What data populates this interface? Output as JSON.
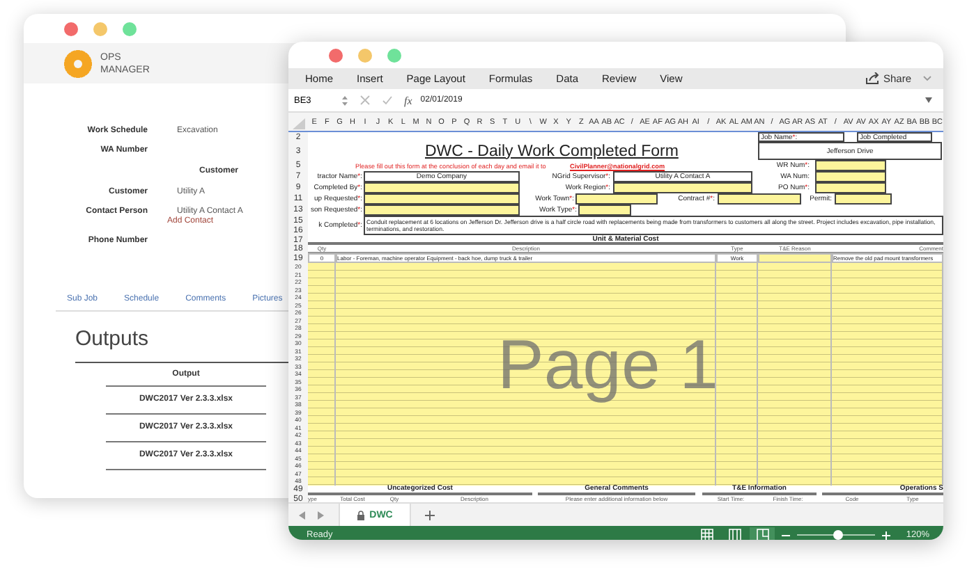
{
  "back_window": {
    "app_name": "OPS MANAGER",
    "fields": [
      {
        "kind": "field",
        "label": "Work Schedule",
        "value": "Excavation"
      },
      {
        "kind": "field",
        "label": "WA Number"
      },
      {
        "kind": "heading",
        "label": "Customer"
      },
      {
        "kind": "field",
        "label": "Customer",
        "value": "Utility A"
      },
      {
        "kind": "field",
        "label": "Contact Person",
        "value": "Utility A Contact A"
      },
      {
        "kind": "link",
        "label": "Add Contact"
      },
      {
        "kind": "field",
        "label": "Phone Number"
      }
    ],
    "tabs": [
      "Sub Job",
      "Schedule",
      "Comments",
      "Pictures"
    ],
    "outputs": {
      "title": "Outputs",
      "column": "Output",
      "rows": [
        "DWC2017 Ver 2.3.3.xlsx",
        "DWC2017 Ver 2.3.3.xlsx",
        "DWC2017 Ver 2.3.3.xlsx"
      ]
    }
  },
  "excel": {
    "menu": [
      "Home",
      "Insert",
      "Page Layout",
      "Formulas",
      "Data",
      "Review",
      "View"
    ],
    "share_label": "Share",
    "name_box": "BE3",
    "function_label": "fx",
    "formula": "02/01/2019",
    "column_letters": [
      "E",
      "F",
      "G",
      "H",
      "I",
      "J",
      "K",
      "L",
      "M",
      "N",
      "O",
      "P",
      "Q",
      "R",
      "S",
      "T",
      "U",
      "\\",
      "W",
      "X",
      "Y",
      "Z",
      "AA",
      "AB",
      "AC",
      "/",
      "AE",
      "AF",
      "AG",
      "AH",
      "AI",
      "/",
      "AK",
      "AL",
      "AM",
      "AN",
      "/",
      "AG",
      "AR",
      "AS",
      "AT",
      "/",
      "AV",
      "AV",
      "AX",
      "AY",
      "AZ",
      "BA",
      "BB",
      "BC"
    ],
    "sheet_lines": [
      {
        "numbers": [
          "2"
        ],
        "items": [
          {
            "kind": "box",
            "text": "Job Name",
            "mark": "*",
            "end": ":"
          },
          {
            "kind": "box",
            "text": "Job Completed"
          }
        ]
      },
      {
        "numbers": [
          "3"
        ],
        "items": [
          {
            "kind": "title",
            "text": "DWC - Daily Work Completed Form"
          },
          {
            "kind": "box",
            "text": "Jefferson Drive"
          }
        ]
      },
      {
        "numbers": [
          "5"
        ],
        "items": [
          {
            "kind": "note",
            "text": "Please fill out this form at the conclusion of each day and email it to"
          },
          {
            "kind": "link",
            "text": "CivilPlanner@nationalgrid.com"
          },
          {
            "kind": "label",
            "text": "WR Num",
            "mark": "*",
            "end": ":"
          },
          {
            "kind": "input"
          }
        ]
      },
      {
        "numbers": [
          "7"
        ],
        "items": [
          {
            "kind": "label",
            "text": "tractor Name",
            "mark": "*",
            "end": ":"
          },
          {
            "kind": "box",
            "text": "Demo Company"
          },
          {
            "kind": "label",
            "text": "NGrid Supervisor",
            "mark": "*",
            "end": ":"
          },
          {
            "kind": "box",
            "text": "Utility A Contact A"
          },
          {
            "kind": "label",
            "text": "WA Num:"
          },
          {
            "kind": "input"
          }
        ]
      },
      {
        "numbers": [
          "9"
        ],
        "items": [
          {
            "kind": "label",
            "text": "Completed By",
            "mark": "*",
            "end": ":"
          },
          {
            "kind": "input"
          },
          {
            "kind": "label",
            "text": "Work Region",
            "mark": "*",
            "end": ":"
          },
          {
            "kind": "input"
          },
          {
            "kind": "label",
            "text": "PO Num",
            "mark": "*",
            "end": ":"
          },
          {
            "kind": "input"
          }
        ]
      },
      {
        "numbers": [
          "11"
        ],
        "items": [
          {
            "kind": "label",
            "text": "up Requested",
            "mark": "*",
            "end": ":"
          },
          {
            "kind": "input"
          },
          {
            "kind": "label",
            "text": "Work Town",
            "mark": "*",
            "end": ":"
          },
          {
            "kind": "input"
          },
          {
            "kind": "label",
            "text": "Contract #",
            "mark": "*",
            "end": ":"
          },
          {
            "kind": "input"
          },
          {
            "kind": "label",
            "text": "Permit:"
          },
          {
            "kind": "input"
          }
        ]
      },
      {
        "numbers": [
          "13"
        ],
        "items": [
          {
            "kind": "label",
            "text": "son Requested",
            "mark": "*",
            "end": ":"
          },
          {
            "kind": "input"
          },
          {
            "kind": "label",
            "text": "Work Type",
            "mark": "*",
            "end": ":"
          },
          {
            "kind": "input"
          }
        ]
      },
      {
        "numbers": [
          "15",
          "16"
        ],
        "items": [
          {
            "kind": "label",
            "text": "k Completed",
            "mark": "*",
            "end": ":"
          },
          {
            "kind": "box",
            "text": "Conduit replacement at 6 locations on Jefferson Dr. Jefferson drive is a half circle road with replacements being made from transformers to customers all along the street. Project includes excavation, pipe installation, terminations, and restoration."
          }
        ]
      },
      {
        "numbers": [
          "17"
        ],
        "items": [
          {
            "kind": "section",
            "text": "Unit & Material Cost"
          }
        ]
      },
      {
        "numbers": [
          "18"
        ],
        "items": [
          {
            "kind": "header",
            "text": "Qty"
          },
          {
            "kind": "header",
            "text": "Description"
          },
          {
            "kind": "header",
            "text": "Type"
          },
          {
            "kind": "header",
            "text": "T&E Reason"
          },
          {
            "kind": "header",
            "text": "Comment"
          }
        ]
      },
      {
        "numbers": [
          "19"
        ],
        "items": [
          {
            "kind": "text",
            "text": "0"
          },
          {
            "kind": "text",
            "text": "Labor - Foreman, machine operator Equipment - back hoe, dump truck & trailer"
          },
          {
            "kind": "text",
            "text": "Work"
          },
          {
            "kind": "input"
          },
          {
            "kind": "text",
            "text": "Remove the old pad mount transformers"
          }
        ]
      },
      {
        "numbers": [
          "20",
          "21",
          "22",
          "23",
          "24",
          "25",
          "26",
          "27",
          "28",
          "29",
          "30",
          "31",
          "32",
          "33",
          "34",
          "35",
          "36",
          "37",
          "38",
          "39",
          "40",
          "41",
          "42",
          "43",
          "44",
          "45",
          "46",
          "47",
          "48"
        ],
        "items": [
          {
            "kind": "block"
          },
          {
            "kind": "block"
          },
          {
            "kind": "block"
          },
          {
            "kind": "block"
          },
          {
            "kind": "block"
          }
        ]
      },
      {
        "numbers": [
          "49"
        ],
        "items": [
          {
            "kind": "section",
            "text": "Uncategorized Cost"
          },
          {
            "kind": "section",
            "text": "General Comments"
          },
          {
            "kind": "section",
            "text": "T&E Information"
          },
          {
            "kind": "section",
            "text": "Operations S"
          }
        ]
      },
      {
        "numbers": [
          "50"
        ],
        "items": [
          {
            "kind": "header",
            "text": "ype"
          },
          {
            "kind": "header",
            "text": "Total Cost"
          },
          {
            "kind": "header",
            "text": "Qty"
          },
          {
            "kind": "header",
            "text": "Description"
          },
          {
            "kind": "header",
            "text": "Please enter additional information below"
          },
          {
            "kind": "header",
            "text": "Start Time:"
          },
          {
            "kind": "header",
            "text": "Finish Time:"
          },
          {
            "kind": "header",
            "text": "Code"
          },
          {
            "kind": "header",
            "text": "Type"
          }
        ]
      }
    ],
    "page_label": "Page 1",
    "sheet_tabs": [
      {
        "label": "DWC",
        "selected": true,
        "locked": true
      }
    ],
    "status": "Ready",
    "views": [
      {
        "kind": "normal",
        "selected": false
      },
      {
        "kind": "layout",
        "selected": false
      },
      {
        "kind": "break",
        "selected": true
      }
    ],
    "zoom": {
      "level": 0.52,
      "reading": "120%"
    }
  }
}
